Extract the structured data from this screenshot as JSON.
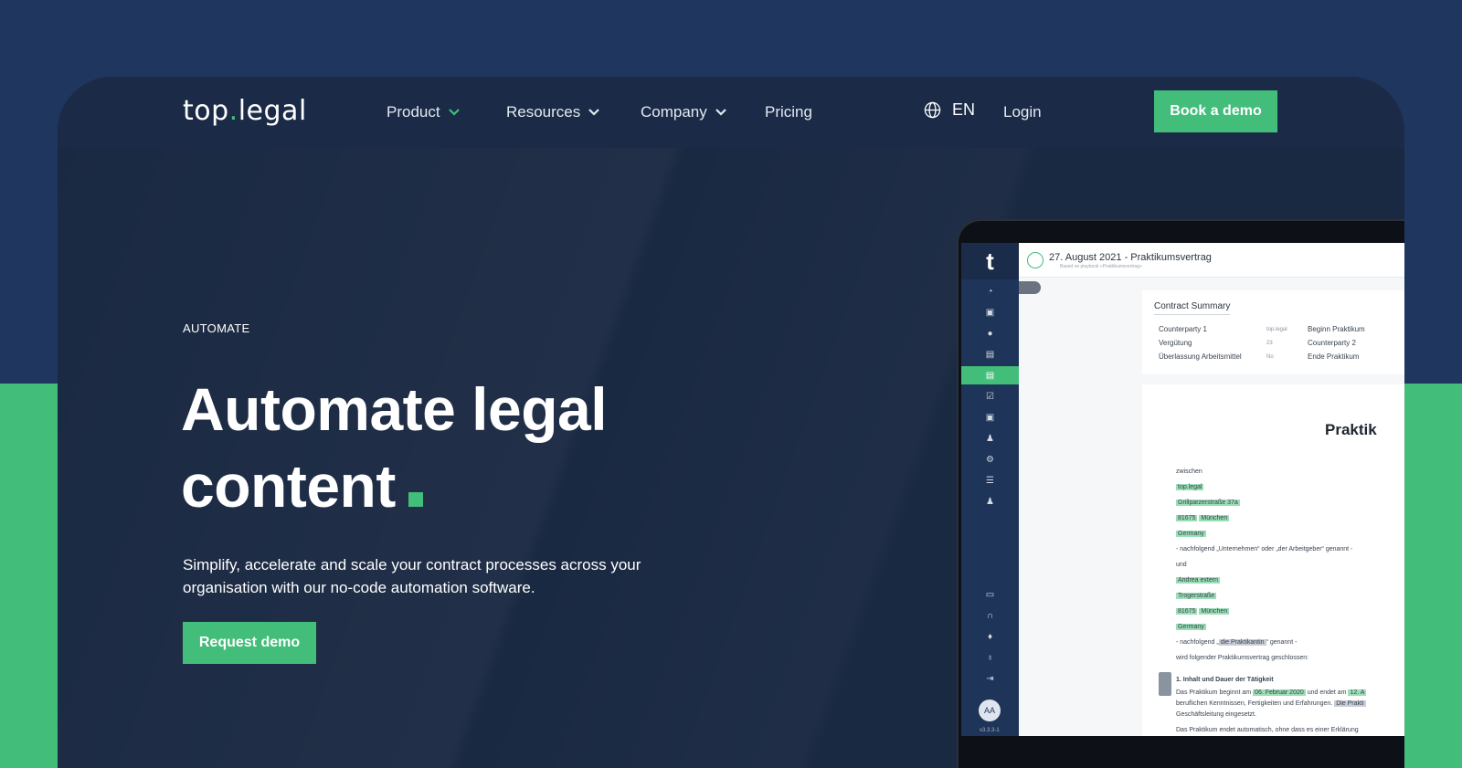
{
  "nav": {
    "logo_main": "top",
    "logo_dot": ".",
    "logo_tail": "legal",
    "items": [
      {
        "label": "Product"
      },
      {
        "label": "Resources"
      },
      {
        "label": "Company"
      },
      {
        "label": "Pricing"
      }
    ],
    "language": "EN",
    "login": "Login",
    "cta": "Book a demo"
  },
  "hero": {
    "eyebrow": "AUTOMATE",
    "headline_line1": "Automate legal",
    "headline_line2": "content",
    "subtitle": "Simplify, accelerate and scale your contract processes across your organisation with our no-code automation software.",
    "cta": "Request demo"
  },
  "app": {
    "logo": "t",
    "doc_title": "27. August 2021 - Praktikumsvertrag",
    "doc_subtitle": "Based on playbook «Praktikumsvertrag»",
    "avatar": "AA",
    "version": "v3.3.3-1",
    "summary": {
      "title": "Contract Summary",
      "rows": [
        {
          "label": "Counterparty 1",
          "value": "top.legal",
          "right": "Beginn Praktikum"
        },
        {
          "label": "Vergütung",
          "value": "23",
          "right": "Counterparty 2"
        },
        {
          "label": "Überlassung Arbeitsmittel",
          "value": "No",
          "right": "Ende Praktikum"
        }
      ]
    },
    "document": {
      "heading": "Praktik",
      "zwischen": "zwischen",
      "party1": [
        "top.legal",
        "Grillparzerstraße 37a",
        "81675",
        "München",
        "Germany"
      ],
      "party1_note": "- nachfolgend „Unternehmen“ oder „der Arbeitgeber“ genannt -",
      "und": "und",
      "party2": [
        "Andrea extern",
        "Trogerstraße",
        "81675",
        "München",
        "Germany"
      ],
      "party2_note_pre": "- nachfolgend „",
      "party2_note_hl": "die Praktikantin",
      "party2_note_post": "“ genannt -",
      "concluded": "wird folgender Praktikumsvertrag geschlossen:",
      "section1": "1. Inhalt und Dauer der Tätigkeit",
      "s1_pre": "Das Praktikum beginnt am",
      "s1_date": "06. Februar 2020",
      "s1_mid": "und endet am",
      "s1_end": "12. A",
      "s1_line2": "beruflichen Kenntnissen, Fertigkeiten und Erfahrungen.",
      "s1_line2_hl": "Die Prakti",
      "s1_line3": "Geschäftsleitung eingesetzt.",
      "s1_line4": "Das Praktikum endet automatisch, ohne dass es einer Erklärung"
    }
  },
  "colors": {
    "accent": "#43be7a",
    "background": "#1f365e",
    "card": "#1a2942"
  }
}
